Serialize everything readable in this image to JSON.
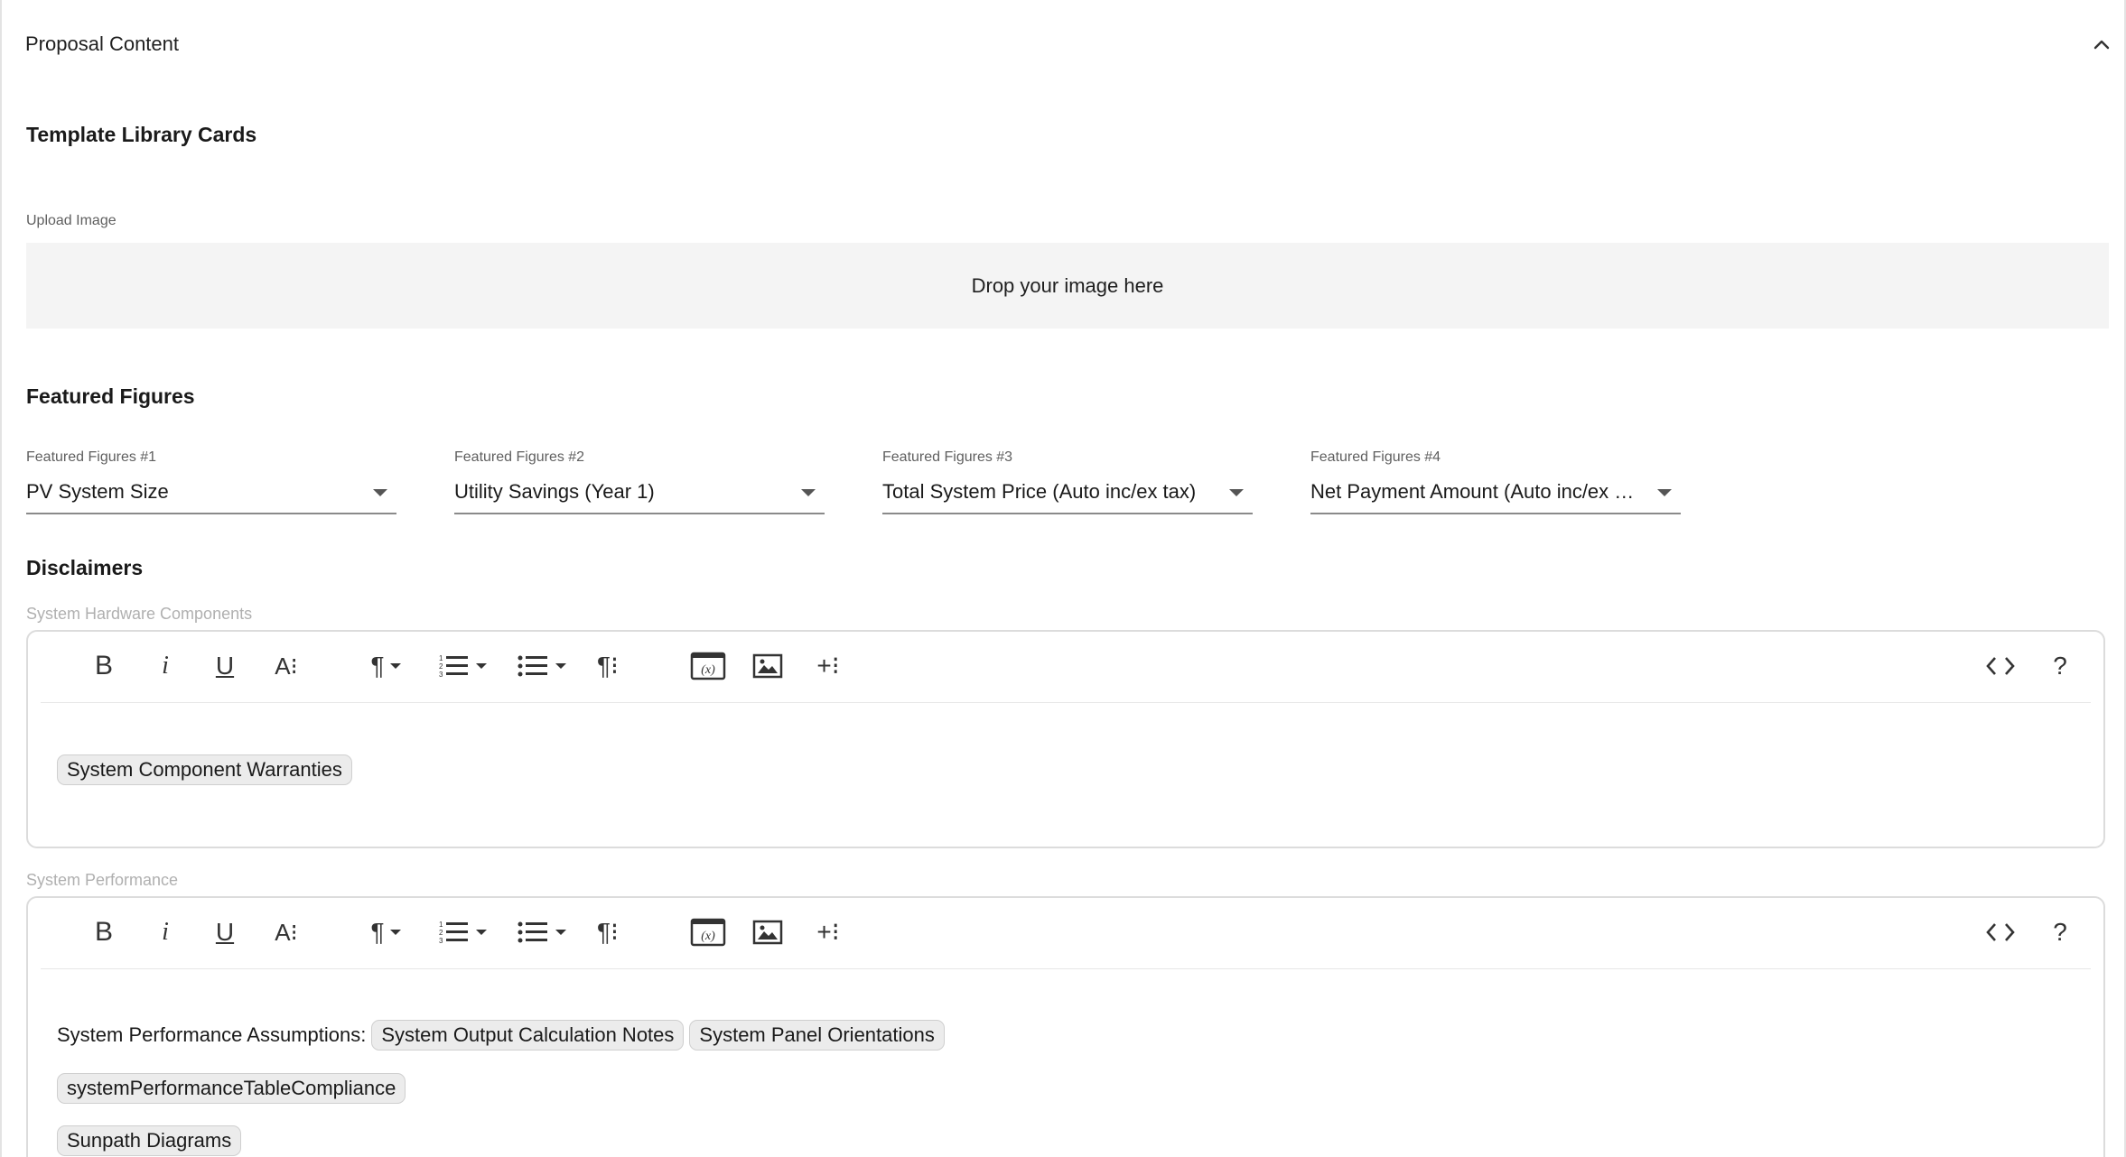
{
  "header": {
    "title": "Proposal Content",
    "collapse_icon": "chevron-up-icon"
  },
  "template_library": {
    "title": "Template Library Cards",
    "upload_label": "Upload Image",
    "dropzone_text": "Drop your image here"
  },
  "featured_figures": {
    "title": "Featured Figures",
    "fields": [
      {
        "label": "Featured Figures #1",
        "value": "PV System Size"
      },
      {
        "label": "Featured Figures #2",
        "value": "Utility Savings (Year 1)"
      },
      {
        "label": "Featured Figures #3",
        "value": "Total System Price (Auto inc/ex tax)"
      },
      {
        "label": "Featured Figures #4",
        "value": "Net Payment Amount (Auto inc/ex …"
      }
    ]
  },
  "disclaimers": {
    "title": "Disclaimers",
    "editors": [
      {
        "label": "System Hardware Components",
        "lines": [
          {
            "text": "",
            "chips": [
              "System Component Warranties"
            ]
          }
        ]
      },
      {
        "label": "System Performance",
        "lines": [
          {
            "text": "System Performance Assumptions:",
            "chips": [
              "System Output Calculation Notes",
              "System Panel Orientations"
            ]
          },
          {
            "text": "",
            "chips": [
              "systemPerformanceTableCompliance"
            ]
          },
          {
            "text": "",
            "chips": [
              "Sunpath Diagrams"
            ]
          }
        ]
      }
    ]
  },
  "toolbar": {
    "bold": "B",
    "italic": "i",
    "underline": "U",
    "text_size": "A⁝",
    "paragraph": "¶",
    "paragraph_format": "¶⁝",
    "insert_more": "+⁝",
    "code_view": "<>",
    "help": "?",
    "icons": [
      "bold-icon",
      "italic-icon",
      "underline-icon",
      "font-size-icon",
      "paragraph-icon",
      "ordered-list-icon",
      "unordered-list-icon",
      "paragraph-format-icon",
      "insert-variable-icon",
      "insert-image-icon",
      "insert-more-icon",
      "code-view-icon",
      "help-icon"
    ]
  }
}
